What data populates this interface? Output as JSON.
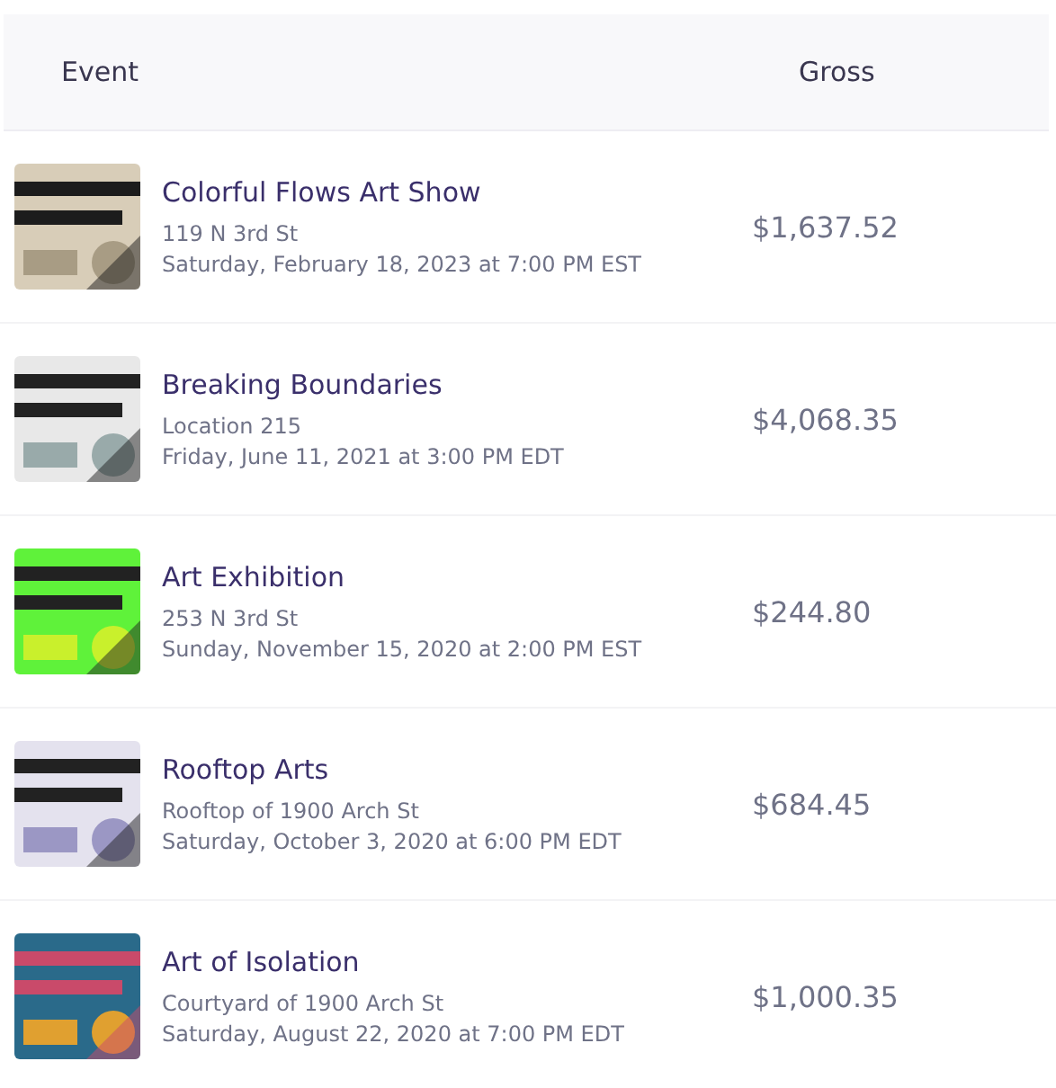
{
  "columns": [
    "Event",
    "Gross"
  ],
  "events": [
    {
      "title": "Colorful Flows Art Show",
      "location": "119 N 3rd St",
      "date": "Saturday, February 18, 2023 at 7:00 PM EST",
      "gross": "$1,637.52"
    },
    {
      "title": "Breaking Boundaries",
      "location": "Location 215",
      "date": "Friday, June 11, 2021 at 3:00 PM EDT",
      "gross": "$4,068.35"
    },
    {
      "title": "Art Exhibition",
      "location": "253 N 3rd St",
      "date": "Sunday, November 15, 2020 at 2:00 PM EST",
      "gross": "$244.80"
    },
    {
      "title": "Rooftop Arts",
      "location": "Rooftop of 1900 Arch St",
      "date": "Saturday, October 3, 2020 at 6:00 PM EDT",
      "gross": "$684.45"
    },
    {
      "title": "Art of Isolation",
      "location": "Courtyard of 1900 Arch St",
      "date": "Saturday, August 22, 2020 at 7:00 PM EDT",
      "gross": "$1,000.35"
    }
  ]
}
